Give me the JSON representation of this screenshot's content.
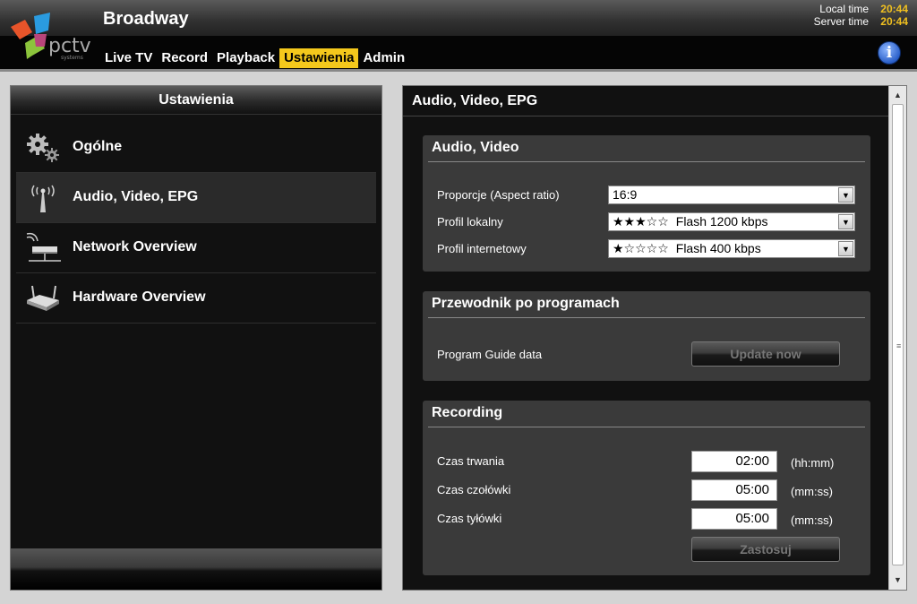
{
  "header": {
    "app_title": "Broadway",
    "nav": [
      "Live TV",
      "Record",
      "Playback",
      "Ustawienia",
      "Admin"
    ],
    "active_nav": "Ustawienia",
    "local_time_label": "Local time",
    "local_time_value": "20:44",
    "server_time_label": "Server time",
    "server_time_value": "20:44",
    "info_glyph": "i"
  },
  "colors": {
    "accent": "#f4c81c",
    "time": "#f0c020"
  },
  "sidebar": {
    "title": "Ustawienia",
    "items": [
      {
        "label": "Ogólne",
        "icon": "gears-icon"
      },
      {
        "label": "Audio, Video, EPG",
        "icon": "antenna-icon",
        "selected": true
      },
      {
        "label": "Network Overview",
        "icon": "network-icon"
      },
      {
        "label": "Hardware Overview",
        "icon": "router-icon"
      }
    ]
  },
  "main": {
    "title": "Audio, Video, EPG",
    "audio_video": {
      "title": "Audio, Video",
      "aspect_label": "Proporcje (Aspect ratio)",
      "aspect_value": "16:9",
      "local_profile_label": "Profil lokalny",
      "local_profile_stars": "★★★☆☆",
      "local_profile_value": "Flash 1200 kbps",
      "internet_profile_label": "Profil internetowy",
      "internet_profile_stars": "★☆☆☆☆",
      "internet_profile_value": "Flash 400 kbps"
    },
    "epg": {
      "title": "Przewodnik po programach",
      "data_label": "Program Guide data",
      "update_button": "Update now"
    },
    "recording": {
      "title": "Recording",
      "duration_label": "Czas trwania",
      "duration_value": "02:00",
      "duration_unit": "(hh:mm)",
      "pre_label": "Czas czołówki",
      "pre_value": "05:00",
      "pre_unit": "(mm:ss)",
      "post_label": "Czas tyłówki",
      "post_value": "05:00",
      "post_unit": "(mm:ss)",
      "apply_button": "Zastosuj"
    }
  }
}
